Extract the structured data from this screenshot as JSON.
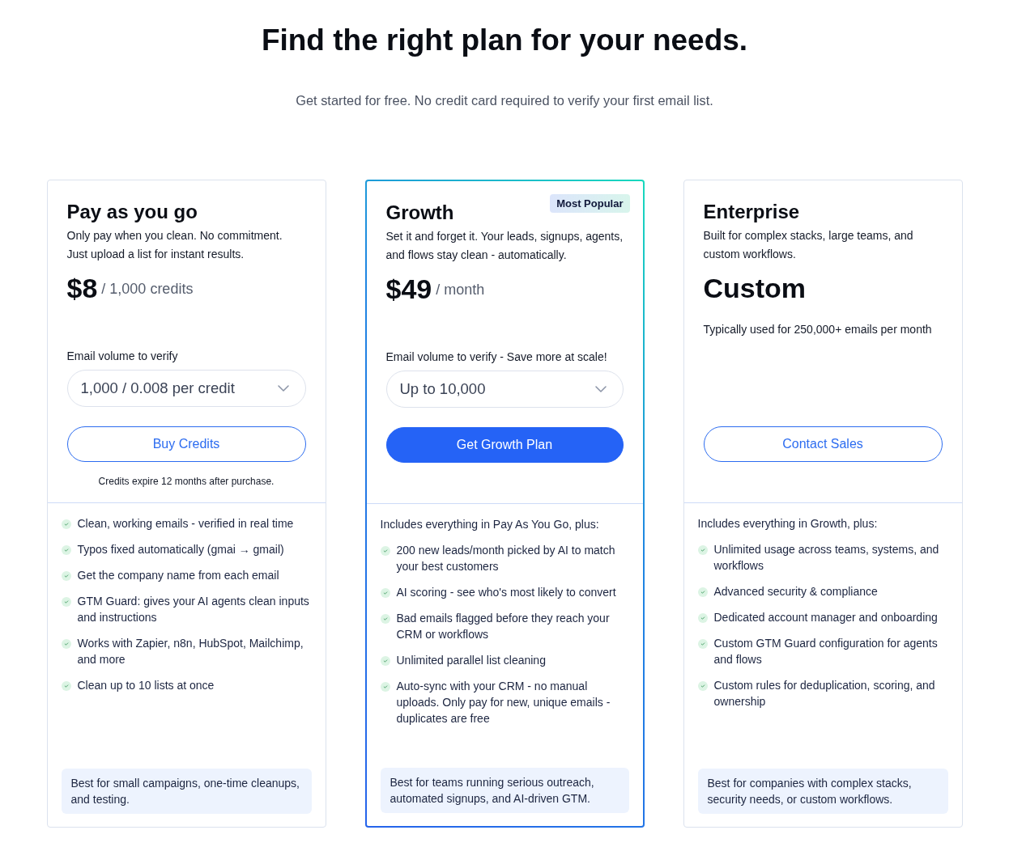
{
  "header": {
    "title": "Find the right plan for your needs.",
    "subtitle": "Get started for free. No credit card required to verify your first email list."
  },
  "plans": [
    {
      "name": "Pay as you go",
      "featured": false,
      "description": "Only pay when you clean. No commitment. Just upload a list for instant results.",
      "price": {
        "amount": "$8",
        "unit": "/ 1,000 credits"
      },
      "volume": {
        "label": "Email volume to verify",
        "value": "1,000 / 0.008 per credit"
      },
      "button": {
        "label": "Buy Credits",
        "kind": "outline"
      },
      "note": "Credits expire 12 months after purchase.",
      "features": [
        "Clean, working emails - verified in real time",
        "Typos fixed automatically (gmai → gmail)",
        "Get the company name from each email",
        "GTM Guard: gives your AI agents clean inputs and instructions",
        "Works with Zapier, n8n, HubSpot, Mailchimp, and more",
        "Clean up to 10 lists at once"
      ],
      "best_for": "Best for small campaigns, one-time cleanups, and testing."
    },
    {
      "name": "Growth",
      "featured": true,
      "badge": "Most Popular",
      "description": "Set it and forget it. Your leads, signups, agents, and flows stay clean - automatically.",
      "price": {
        "amount": "$49",
        "unit": "/ month"
      },
      "volume": {
        "label": "Email volume to verify - Save more at scale!",
        "value": "Up to 10,000"
      },
      "button": {
        "label": "Get Growth Plan",
        "kind": "primary"
      },
      "includes": "Includes everything in Pay As You Go, plus:",
      "features": [
        "200 new leads/month picked by AI to match your best customers",
        "AI scoring - see who's most likely to convert",
        "Bad emails flagged before they reach your CRM or workflows",
        "Unlimited parallel list cleaning",
        "Auto-sync with your CRM - no manual uploads. Only pay for new, unique emails - duplicates are free"
      ],
      "best_for": "Best for teams running serious outreach, automated signups, and AI-driven GTM."
    },
    {
      "name": "Enterprise",
      "featured": false,
      "description": "Built for complex stacks, large teams, and custom workflows.",
      "price": {
        "amount": "Custom"
      },
      "usage": "Typically used for 250,000+ emails per month",
      "button": {
        "label": "Contact Sales",
        "kind": "outline"
      },
      "includes": "Includes everything in Growth, plus:",
      "features": [
        "Unlimited usage across teams, systems, and workflows",
        "Advanced security & compliance",
        "Dedicated account manager and onboarding",
        "Custom GTM Guard configuration for agents and flows",
        "Custom rules for deduplication, scoring, and ownership"
      ],
      "best_for": "Best for companies with complex stacks, security needs, or custom workflows."
    }
  ]
}
